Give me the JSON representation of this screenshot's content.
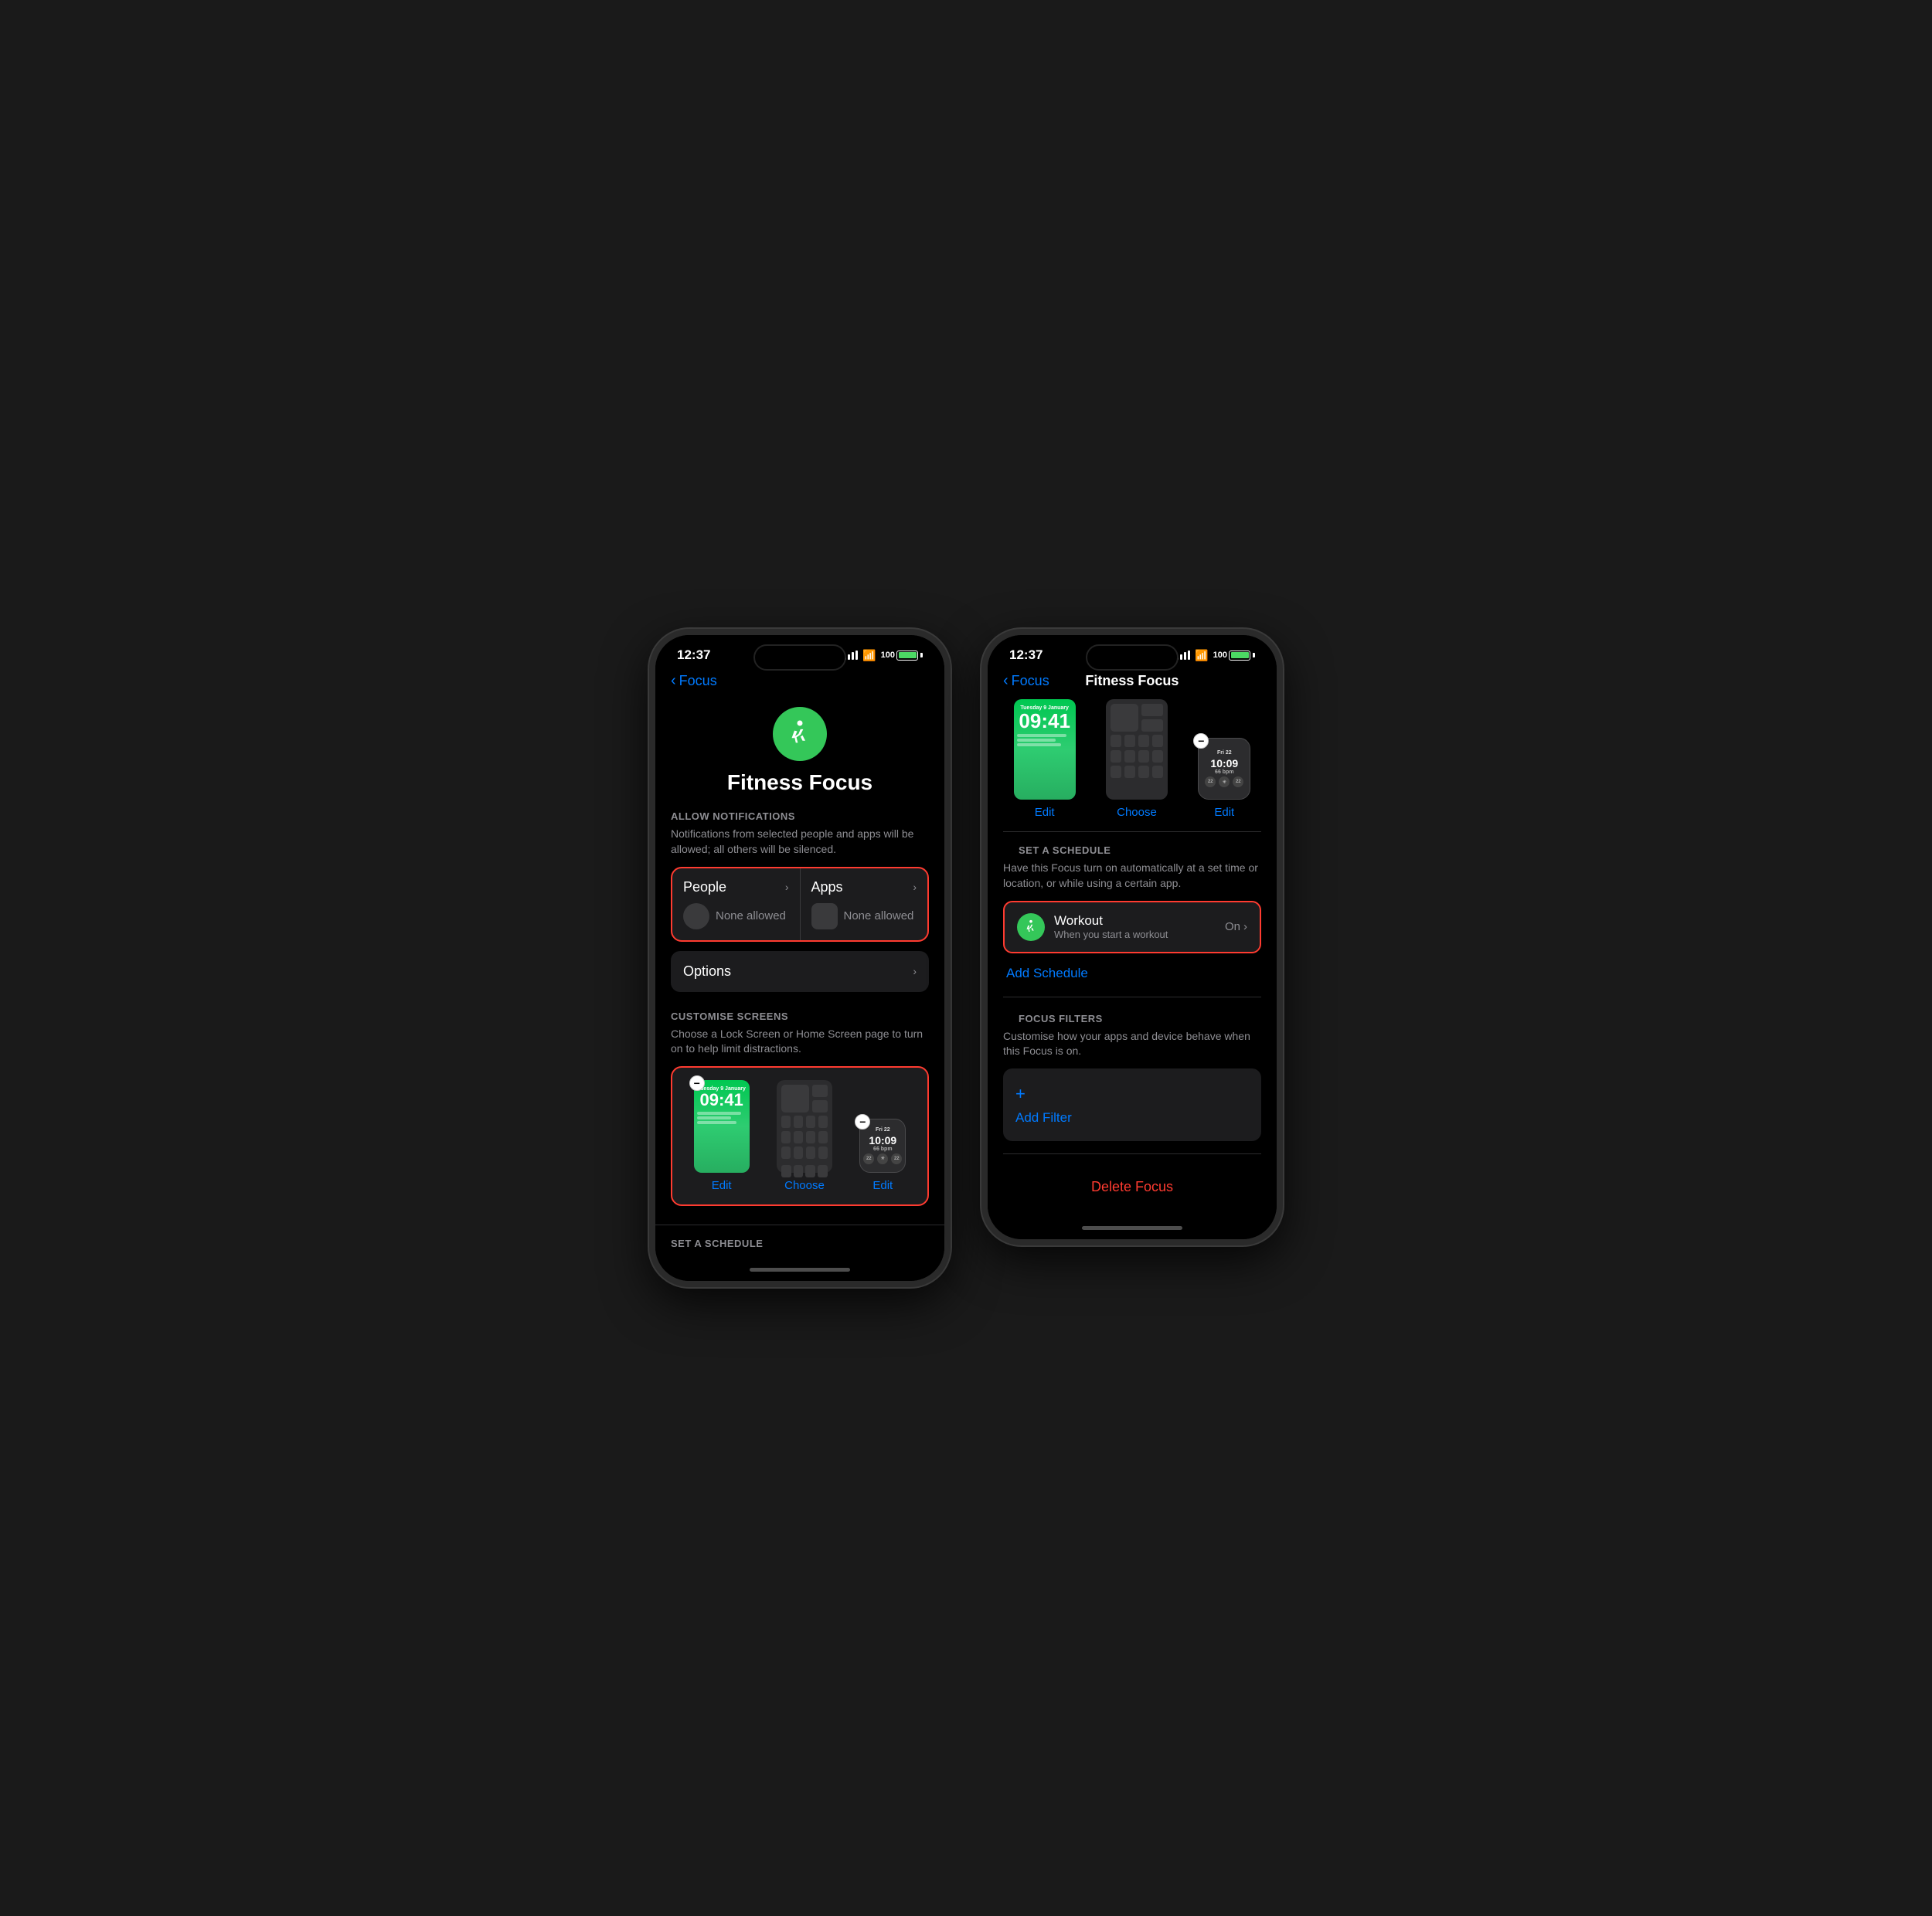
{
  "phone1": {
    "status": {
      "time": "12:37",
      "battery": "100"
    },
    "back_label": "Focus",
    "hero": {
      "title": "Fitness Focus"
    },
    "allow_notifications": {
      "section_label": "ALLOW NOTIFICATIONS",
      "description": "Notifications from selected people and apps will be allowed; all others will be silenced.",
      "people_label": "People",
      "apps_label": "Apps",
      "people_none": "None allowed",
      "apps_none": "None allowed"
    },
    "options": {
      "label": "Options"
    },
    "customise_screens": {
      "section_label": "CUSTOMISE SCREENS",
      "description": "Choose a Lock Screen or Home Screen page to turn on to help limit distractions.",
      "lock_date": "Tuesday 9 January",
      "lock_time": "09:41",
      "screen1_action": "Edit",
      "screen2_action": "Choose",
      "screen3_action": "Edit",
      "watch_time": "10:09",
      "watch_date": "Fri 22"
    },
    "set_schedule": {
      "section_label": "SET A SCHEDULE"
    }
  },
  "phone2": {
    "status": {
      "time": "12:37",
      "battery": "100"
    },
    "back_label": "Focus",
    "nav_title": "Fitness Focus",
    "lock_date": "Tuesday 9 January",
    "lock_time": "09:41",
    "screen1_action": "Edit",
    "screen2_action": "Choose",
    "screen3_action": "Edit",
    "watch_time": "10:09",
    "watch_date": "Fri 22",
    "set_schedule": {
      "section_label": "SET A SCHEDULE",
      "description": "Have this Focus turn on automatically at a set time or location, or while using a certain app.",
      "workout_title": "Workout",
      "workout_subtitle": "When you start a workout",
      "workout_status": "On",
      "add_schedule": "Add Schedule"
    },
    "focus_filters": {
      "section_label": "FOCUS FILTERS",
      "description": "Customise how your apps and device behave when this Focus is on.",
      "add_filter": "Add Filter"
    },
    "delete_focus": "Delete Focus"
  }
}
